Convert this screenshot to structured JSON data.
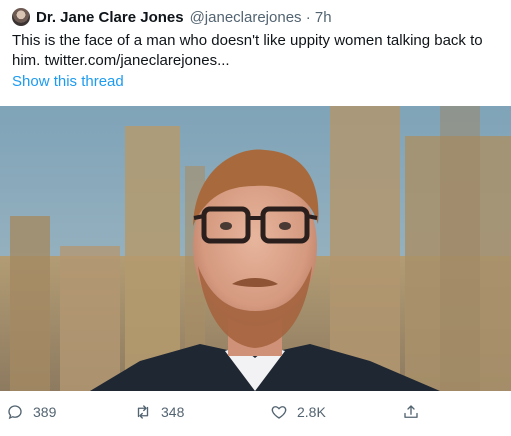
{
  "tweet": {
    "author_name": "Dr. Jane Clare Jones",
    "author_handle_time": "@janeclarejones · 7h",
    "text": "This is the face of a man who doesn't like uppity women talking back to him. twitter.com/janeclarejones...",
    "show_thread": "Show this thread",
    "avatar_icon": "author-avatar"
  },
  "media": {
    "description_icon": "photo-man-with-glasses-in-front-of-parliament"
  },
  "actions": {
    "replies": "389",
    "retweets": "348",
    "likes": "2.8K",
    "reply_icon": "reply-icon",
    "retweet_icon": "retweet-icon",
    "like_icon": "heart-icon",
    "share_icon": "share-icon"
  },
  "colors": {
    "link": "#1d9bf0",
    "muted": "#536471",
    "text": "#0f1419"
  }
}
